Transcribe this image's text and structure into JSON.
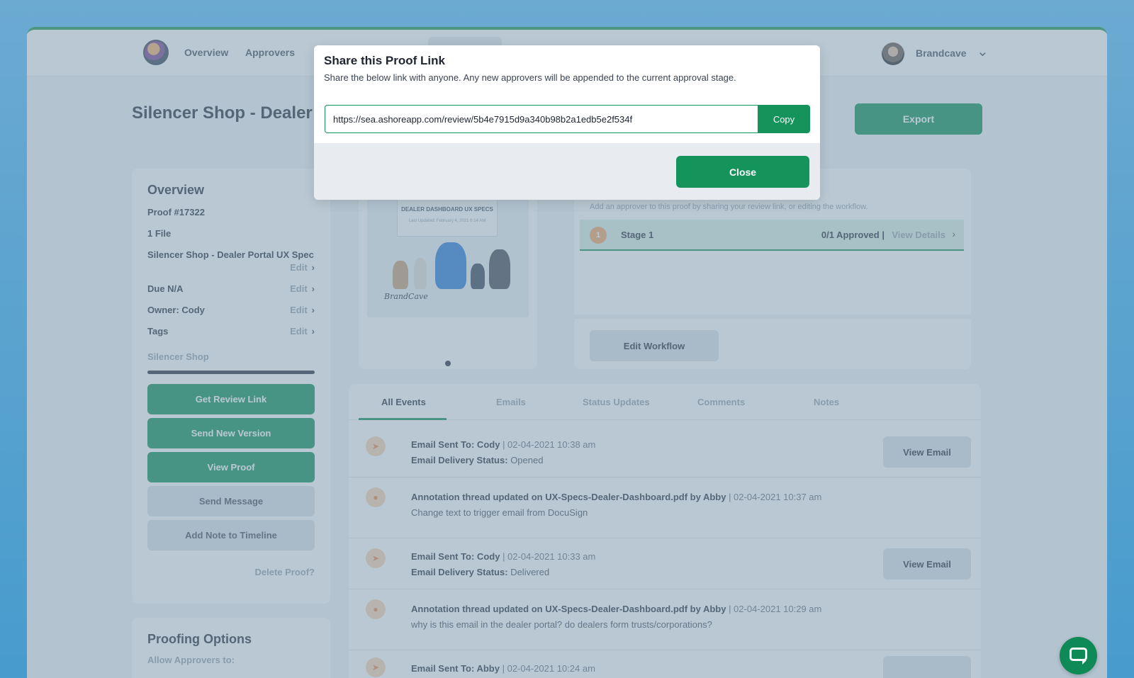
{
  "nav": {
    "overview": "Overview",
    "approvers": "Approvers",
    "user_name": "Brandcave"
  },
  "page": {
    "title": "Silencer Shop - Dealer Po",
    "export_label": "Export"
  },
  "overview": {
    "title": "Overview",
    "proof_number": "Proof #17322",
    "file_count": "1 File",
    "proof_name": "Silencer Shop - Dealer Portal UX Spec",
    "edit_label": "Edit",
    "due": "Due N/A",
    "owner": "Owner: Cody",
    "tags_label": "Tags",
    "tag_value": "Silencer Shop",
    "buttons": {
      "review_link": "Get Review Link",
      "new_version": "Send New Version",
      "view_proof": "View Proof",
      "send_message": "Send Message",
      "add_note": "Add Note to Timeline"
    },
    "delete_label": "Delete Proof?"
  },
  "proofing": {
    "title": "Proofing Options",
    "subtitle": "Allow Approvers to:"
  },
  "thumbnail": {
    "heading": "DEALER DASHBOARD UX SPECS",
    "subheading": "Last Updated: February 4, 2021 6:14 AM",
    "brand": "BrandCave"
  },
  "workflow": {
    "subtitle": "Add an approver to this proof by sharing your review link, or editing the workflow.",
    "stage_number": "1",
    "stage_name": "Stage 1",
    "stage_count": "0/1 Approved",
    "stage_separator": "|",
    "view_details": "View Details",
    "edit_workflow": "Edit Workflow"
  },
  "tabs": [
    "All Events",
    "Emails",
    "Status Updates",
    "Comments",
    "Notes"
  ],
  "events": [
    {
      "main": "Email Sent To: Cody",
      "meta": "| 02-04-2021 10:38 am",
      "sub_label": "Email Delivery Status:",
      "sub_value": "Opened",
      "action": "View Email"
    },
    {
      "main": "Annotation thread updated on UX-Specs-Dealer-Dashboard.pdf by Abby",
      "meta": "| 02-04-2021 10:37 am",
      "sub_value": "Change text to trigger email from DocuSign"
    },
    {
      "main": "Email Sent To: Cody",
      "meta": "| 02-04-2021 10:33 am",
      "sub_label": "Email Delivery Status:",
      "sub_value": "Delivered",
      "action": "View Email"
    },
    {
      "main": "Annotation thread updated on UX-Specs-Dealer-Dashboard.pdf by Abby",
      "meta": "| 02-04-2021 10:29 am",
      "sub_value": "why is this email in the dealer portal? do dealers form trusts/corporations?"
    },
    {
      "main": "Email Sent To: Abby",
      "meta": "| 02-04-2021 10:24 am"
    }
  ],
  "modal": {
    "title": "Share this Proof Link",
    "description": "Share the below link with anyone. Any new approvers will be appended to the current approval stage.",
    "link": "https://sea.ashoreapp.com/review/5b4e7915d9a340b98b2a1edb5e2f534f",
    "copy_label": "Copy",
    "close_label": "Close"
  },
  "colors": {
    "accent": "#14935a",
    "background_top": "#5ec0fb",
    "background_bottom": "#12a2f3",
    "event_icon": "#fbd3b5"
  },
  "icons": [
    "logo-icon",
    "chevron-down-icon",
    "chevron-right-icon",
    "rocket-icon",
    "bell-icon",
    "chat-icon"
  ]
}
